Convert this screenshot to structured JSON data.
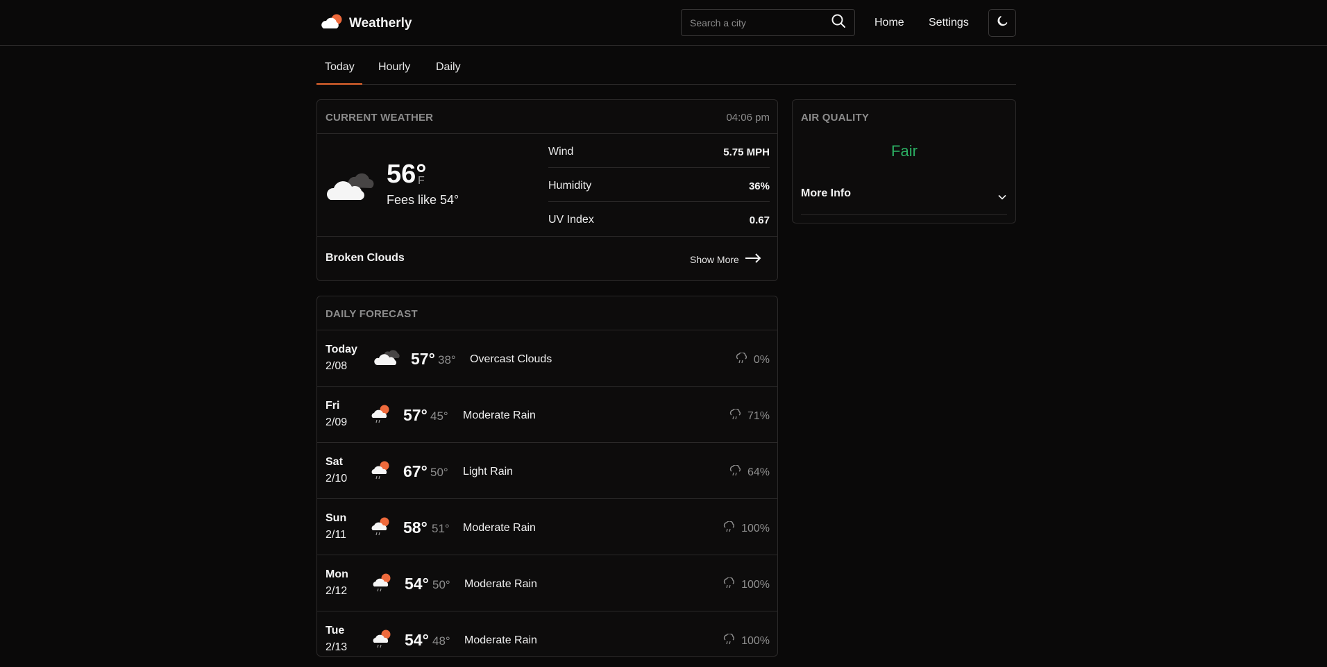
{
  "header": {
    "app_name": "Weatherly",
    "search_placeholder": "Search a city",
    "nav": {
      "home": "Home",
      "settings": "Settings"
    }
  },
  "tabs": [
    {
      "label": "Today",
      "active": true
    },
    {
      "label": "Hourly",
      "active": false
    },
    {
      "label": "Daily",
      "active": false
    }
  ],
  "current": {
    "title": "CURRENT WEATHER",
    "time": "04:06 pm",
    "temp": "56°",
    "unit": "F",
    "feels_like": "Fees like 54°",
    "stats": [
      {
        "label": "Wind",
        "value": "5.75 MPH"
      },
      {
        "label": "Humidity",
        "value": "36%"
      },
      {
        "label": "UV Index",
        "value": "0.67"
      }
    ],
    "condition": "Broken Clouds",
    "show_more": "Show More"
  },
  "air_quality": {
    "title": "AIR QUALITY",
    "value": "Fair",
    "value_color": "#2bad62",
    "more_info": "More Info"
  },
  "forecast": {
    "title": "DAILY FORECAST",
    "days": [
      {
        "day": "Today",
        "date": "2/08",
        "hi": "57°",
        "lo": "38°",
        "desc": "Overcast Clouds",
        "precip": "0%",
        "icon": "overcast-cloud-icon"
      },
      {
        "day": "Fri",
        "date": "2/09",
        "hi": "57°",
        "lo": "45°",
        "desc": "Moderate Rain",
        "precip": "71%",
        "icon": "rain-sun-cloud-icon"
      },
      {
        "day": "Sat",
        "date": "2/10",
        "hi": "67°",
        "lo": "50°",
        "desc": "Light Rain",
        "precip": "64%",
        "icon": "rain-sun-cloud-icon"
      },
      {
        "day": "Sun",
        "date": "2/11",
        "hi": "58°",
        "lo": "51°",
        "desc": "Moderate Rain",
        "precip": "100%",
        "icon": "rain-sun-cloud-icon"
      },
      {
        "day": "Mon",
        "date": "2/12",
        "hi": "54°",
        "lo": "50°",
        "desc": "Moderate Rain",
        "precip": "100%",
        "icon": "rain-sun-cloud-icon"
      },
      {
        "day": "Tue",
        "date": "2/13",
        "hi": "54°",
        "lo": "48°",
        "desc": "Moderate Rain",
        "precip": "100%",
        "icon": "rain-sun-cloud-icon"
      }
    ]
  },
  "colors": {
    "accent": "#e8672e",
    "background": "#0a0909",
    "good": "#2bad62"
  }
}
